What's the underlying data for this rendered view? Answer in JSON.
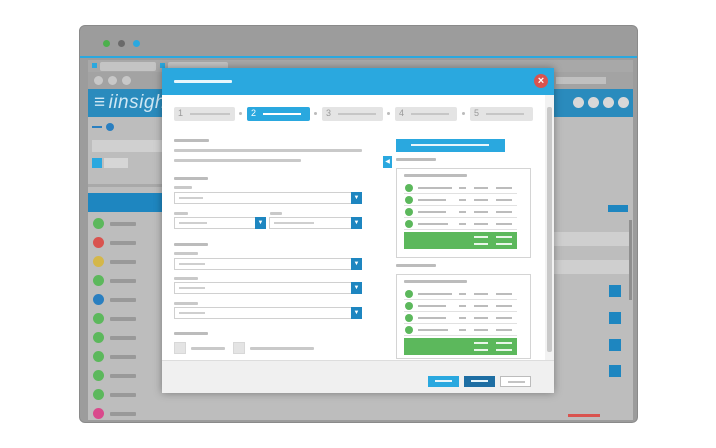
{
  "app": {
    "logo_mark": "≡",
    "logo_text": "iinsight",
    "brand_color": "#2aa8df",
    "header_color": "#2a8bbd"
  },
  "window_controls": [
    {
      "name": "close",
      "color": "#4cb04c"
    },
    {
      "name": "minimize",
      "color": "#6a6a6a"
    },
    {
      "name": "maximize",
      "color": "#2aa8df"
    }
  ],
  "wizard": {
    "close_glyph": "×",
    "close_color": "#d9534f",
    "steps": [
      {
        "num": "1",
        "active": false
      },
      {
        "num": "2",
        "active": true
      },
      {
        "num": "3",
        "active": false
      },
      {
        "num": "4",
        "active": false
      },
      {
        "num": "5",
        "active": false
      }
    ],
    "dropdown_caret": "▼",
    "collapse_caret": "◀",
    "success_color": "#5cb85c"
  },
  "background_status_icons": [
    {
      "color": "#5cb85c"
    },
    {
      "color": "#d9534f"
    },
    {
      "color": "#d4b74a"
    },
    {
      "color": "#5cb85c"
    },
    {
      "color": "#2a7fc0"
    },
    {
      "color": "#5cb85c"
    },
    {
      "color": "#5cb85c"
    },
    {
      "color": "#5cb85c"
    },
    {
      "color": "#5cb85c"
    },
    {
      "color": "#5cb85c"
    },
    {
      "color": "#d94a8c"
    }
  ]
}
